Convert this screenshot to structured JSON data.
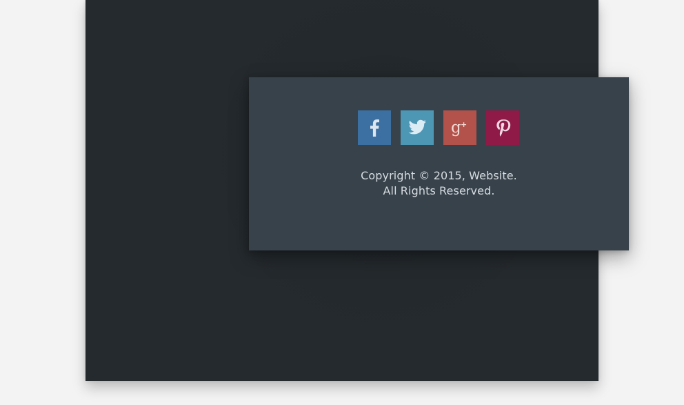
{
  "colors": {
    "page_background": "#f3f3f3",
    "dark_panel": "#242a2e",
    "footer_card": "#37424b",
    "facebook": "#3c6fa2",
    "twitter": "#4d97b5",
    "googleplus": "#b2524a",
    "pinterest": "#8f1a47",
    "text": "#d7dde1"
  },
  "footer": {
    "social_links": [
      {
        "name": "facebook",
        "icon": "facebook-icon"
      },
      {
        "name": "twitter",
        "icon": "twitter-icon"
      },
      {
        "name": "googleplus",
        "icon": "google-plus-icon"
      },
      {
        "name": "pinterest",
        "icon": "pinterest-icon"
      }
    ],
    "copyright_line_1": "Copyright © 2015, Website.",
    "copyright_line_2": "All Rights Reserved."
  }
}
